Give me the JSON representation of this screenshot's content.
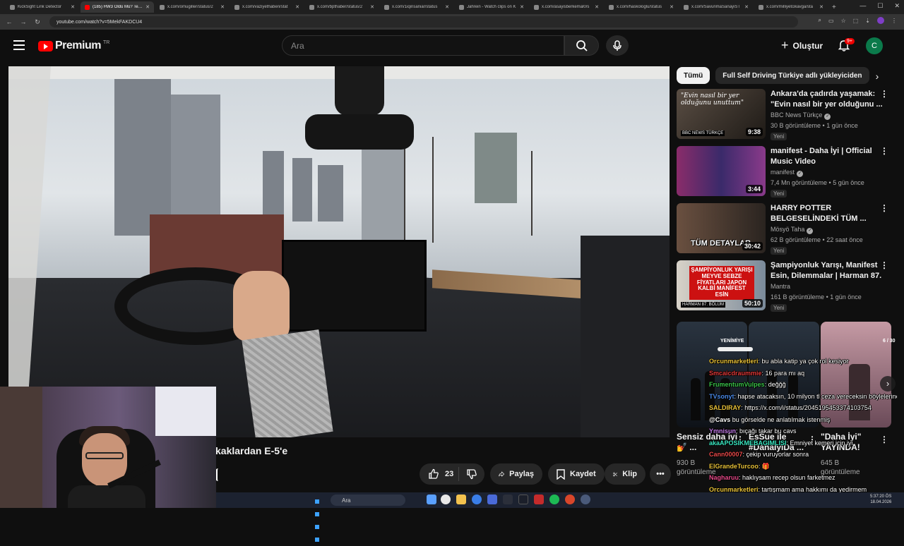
{
  "browser": {
    "tabs": [
      {
        "label": "KickSight Link Detector",
        "active": false
      },
      {
        "label": "(185) HW3 Öldü Mü? Tesla",
        "active": true
      },
      {
        "label": "x.com/omugiller/status/2",
        "active": false
      },
      {
        "label": "x.com/vaziyethaberi/stat",
        "active": false
      },
      {
        "label": "x.com/bpthaber/status/2",
        "active": false
      },
      {
        "label": "x.com/1iqinsaniar/status",
        "active": false
      },
      {
        "label": "Jahrein - Watch clips on K",
        "active": false
      },
      {
        "label": "x.com/asayisberkemal0/s",
        "active": false
      },
      {
        "label": "x.com/haskologlu/status",
        "active": false
      },
      {
        "label": "x.com/SavunmaSanayiST",
        "active": false
      },
      {
        "label": "x.com/milliyetcikavga/sta",
        "active": false
      }
    ],
    "new_tab": "+",
    "url": "youtube.com/watch?v=5MekFAKDCU4"
  },
  "header": {
    "logo_text": "Premium",
    "logo_country": "TR",
    "search_placeholder": "Ara",
    "create_label": "Oluştur",
    "notifications_badge": "9+",
    "avatar_letter": "C"
  },
  "video": {
    "title_visible": "kaklardan E-5'e",
    "likes": "23",
    "share_label": "Paylaş",
    "save_label": "Kaydet",
    "clip_label": "Klip",
    "more_label": "•••"
  },
  "sidebar": {
    "chips": [
      {
        "label": "Tümü",
        "active": true
      },
      {
        "label": "Full Self Driving Türkiye adlı yükleyiciden",
        "active": false
      }
    ],
    "recommendations": [
      {
        "title": "Ankara'da çadırda yaşamak: \"Evin nasıl bir yer olduğunu ...",
        "channel": "BBC News Türkçe",
        "verified": true,
        "views": "30 B görüntüleme",
        "age": "1 gün önce",
        "badge": "Yeni",
        "duration": "9:38",
        "thumb_caption": "\"Evin nasıl bir yer olduğunu unuttum\"",
        "thumb_tag": "BBC NEWS TÜRKÇE"
      },
      {
        "title": "manifest - Daha İyi | Official Music Video",
        "channel": "manifest",
        "verified": true,
        "views": "7,4 Mn görüntüleme",
        "age": "5 gün önce",
        "badge": "Yeni",
        "duration": "3:44"
      },
      {
        "title": "HARRY POTTER BELGESELİNDEKİ TÜM ...",
        "channel": "Mösyö Taha",
        "verified": true,
        "views": "62 B görüntüleme",
        "age": "22 saat önce",
        "badge": "Yeni",
        "duration": "30:42",
        "thumb_caption": "TÜM DETAYLAR"
      },
      {
        "title": "Şampiyonluk Yarışı, Manifest Esin, Dilemmalar | Harman 87. ...",
        "channel": "Mantra",
        "verified": false,
        "views": "161 B görüntüleme",
        "age": "1 gün önce",
        "badge": "Yeni",
        "duration": "50:10",
        "thumb_caption": "ŞAMPİYONLUK YARIŞI MEYVE SEBZE FİYATLARI JAPON KALBİ MANİFEST ESİN",
        "thumb_tag": "HARMAN 87. BÖLÜM"
      }
    ],
    "shorts": [
      {
        "title": "Sensiz daha iyi💅 ...",
        "views": "930 B görüntüleme"
      },
      {
        "title": "EsSue ile #DahaIyiDa ...",
        "views": ""
      },
      {
        "title": "\"Daha İyi\" YAYINDA!",
        "views": "645 B görüntüleme"
      }
    ],
    "shorts_overlay_left": "YENİMİYE",
    "shorts_overlay_right": "6 / 30"
  },
  "chat": {
    "lines": [
      {
        "user": "Orcunmarketleri",
        "color": "#e8c23a",
        "text": ": bu abla katip ya çok rol kesiyor"
      },
      {
        "user": "Smcaicdraummie",
        "color": "#e23a3a",
        "text": ": 16 para mı aq"
      },
      {
        "user": "FrumentumVulpes",
        "color": "#3ac24a",
        "text": ": değğğ"
      },
      {
        "user": "TVsonyt",
        "color": "#4a8ae8",
        "text": ": hapse atacaksın, 10 milyon tl ceza vereceksin böylelerine"
      },
      {
        "user": "SALDIRAY",
        "color": "#e8c23a",
        "text": ": https://x.com/i/status/2045195453374103754"
      },
      {
        "user": "@Cavs",
        "color": "#ffffff",
        "text": " bu görselde ne anlatılmak istenmiş"
      },
      {
        "user": "Ymnisun",
        "color": "#c27ae8",
        "text": ": bıçağı takar bu cavs"
      },
      {
        "user": "akaAPOSIKMEBAGIMLISI",
        "color": "#3ae8c2",
        "text": ": Emniyet kemeri için iyi"
      },
      {
        "user": "Cann00007",
        "color": "#e84a4a",
        "text": ": çekip vuruyorlar sonra"
      },
      {
        "user": "ElGrandeTurcoo",
        "color": "#e8c23a",
        "text": ": 🎁"
      },
      {
        "user": "Nagharuu",
        "color": "#e84a8a",
        "text": ": haklıysam recep olsun farketmez"
      },
      {
        "user": "Orcunmarketleri",
        "color": "#e8c23a",
        "text": ": tartışmam ama hakkımı da yedirmem"
      }
    ]
  },
  "taskbar": {
    "search_placeholder": "Ara",
    "time": "5:37:20 ÖS",
    "date": "18.04.2026"
  },
  "colors": {
    "background": "#0f0f0f",
    "accent_red": "#ff0000",
    "avatar": "#0b7a4b"
  }
}
